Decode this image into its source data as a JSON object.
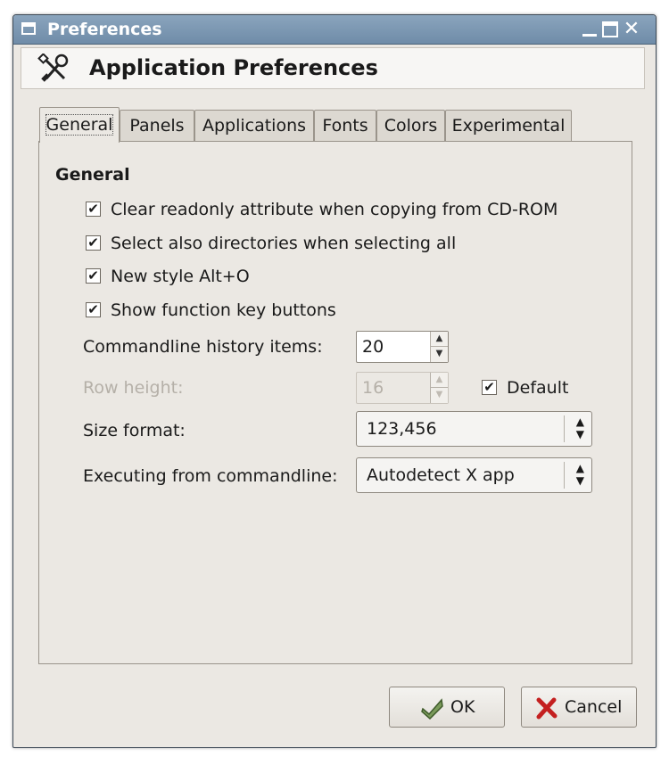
{
  "window": {
    "title": "Preferences",
    "close_glyph": "✕"
  },
  "header": {
    "title": "Application Preferences",
    "icon": "tools-icon"
  },
  "tabs": [
    {
      "label": "General",
      "active": true
    },
    {
      "label": "Panels",
      "active": false
    },
    {
      "label": "Applications",
      "active": false
    },
    {
      "label": "Fonts",
      "active": false
    },
    {
      "label": "Colors",
      "active": false
    },
    {
      "label": "Experimental",
      "active": false
    }
  ],
  "general": {
    "section_title": "General",
    "checkboxes": [
      {
        "label": "Clear readonly attribute when copying from CD-ROM",
        "checked": true
      },
      {
        "label": "Select also directories when selecting all",
        "checked": true
      },
      {
        "label": "New style Alt+O",
        "checked": true
      },
      {
        "label": "Show function key buttons",
        "checked": true
      }
    ],
    "check_glyph": "✔",
    "history": {
      "label": "Commandline history items:",
      "value": "20"
    },
    "row_height": {
      "label": "Row height:",
      "value": "16",
      "enabled": false
    },
    "default_check": {
      "label": "Default",
      "checked": true
    },
    "size_format": {
      "label": "Size format:",
      "value": "123,456"
    },
    "executing": {
      "label": "Executing from commandline:",
      "value": "Autodetect X app"
    },
    "spin_up": "▲",
    "spin_down": "▼",
    "combo_arrows": "▲\n▼"
  },
  "buttons": {
    "ok": "OK",
    "cancel": "Cancel"
  }
}
